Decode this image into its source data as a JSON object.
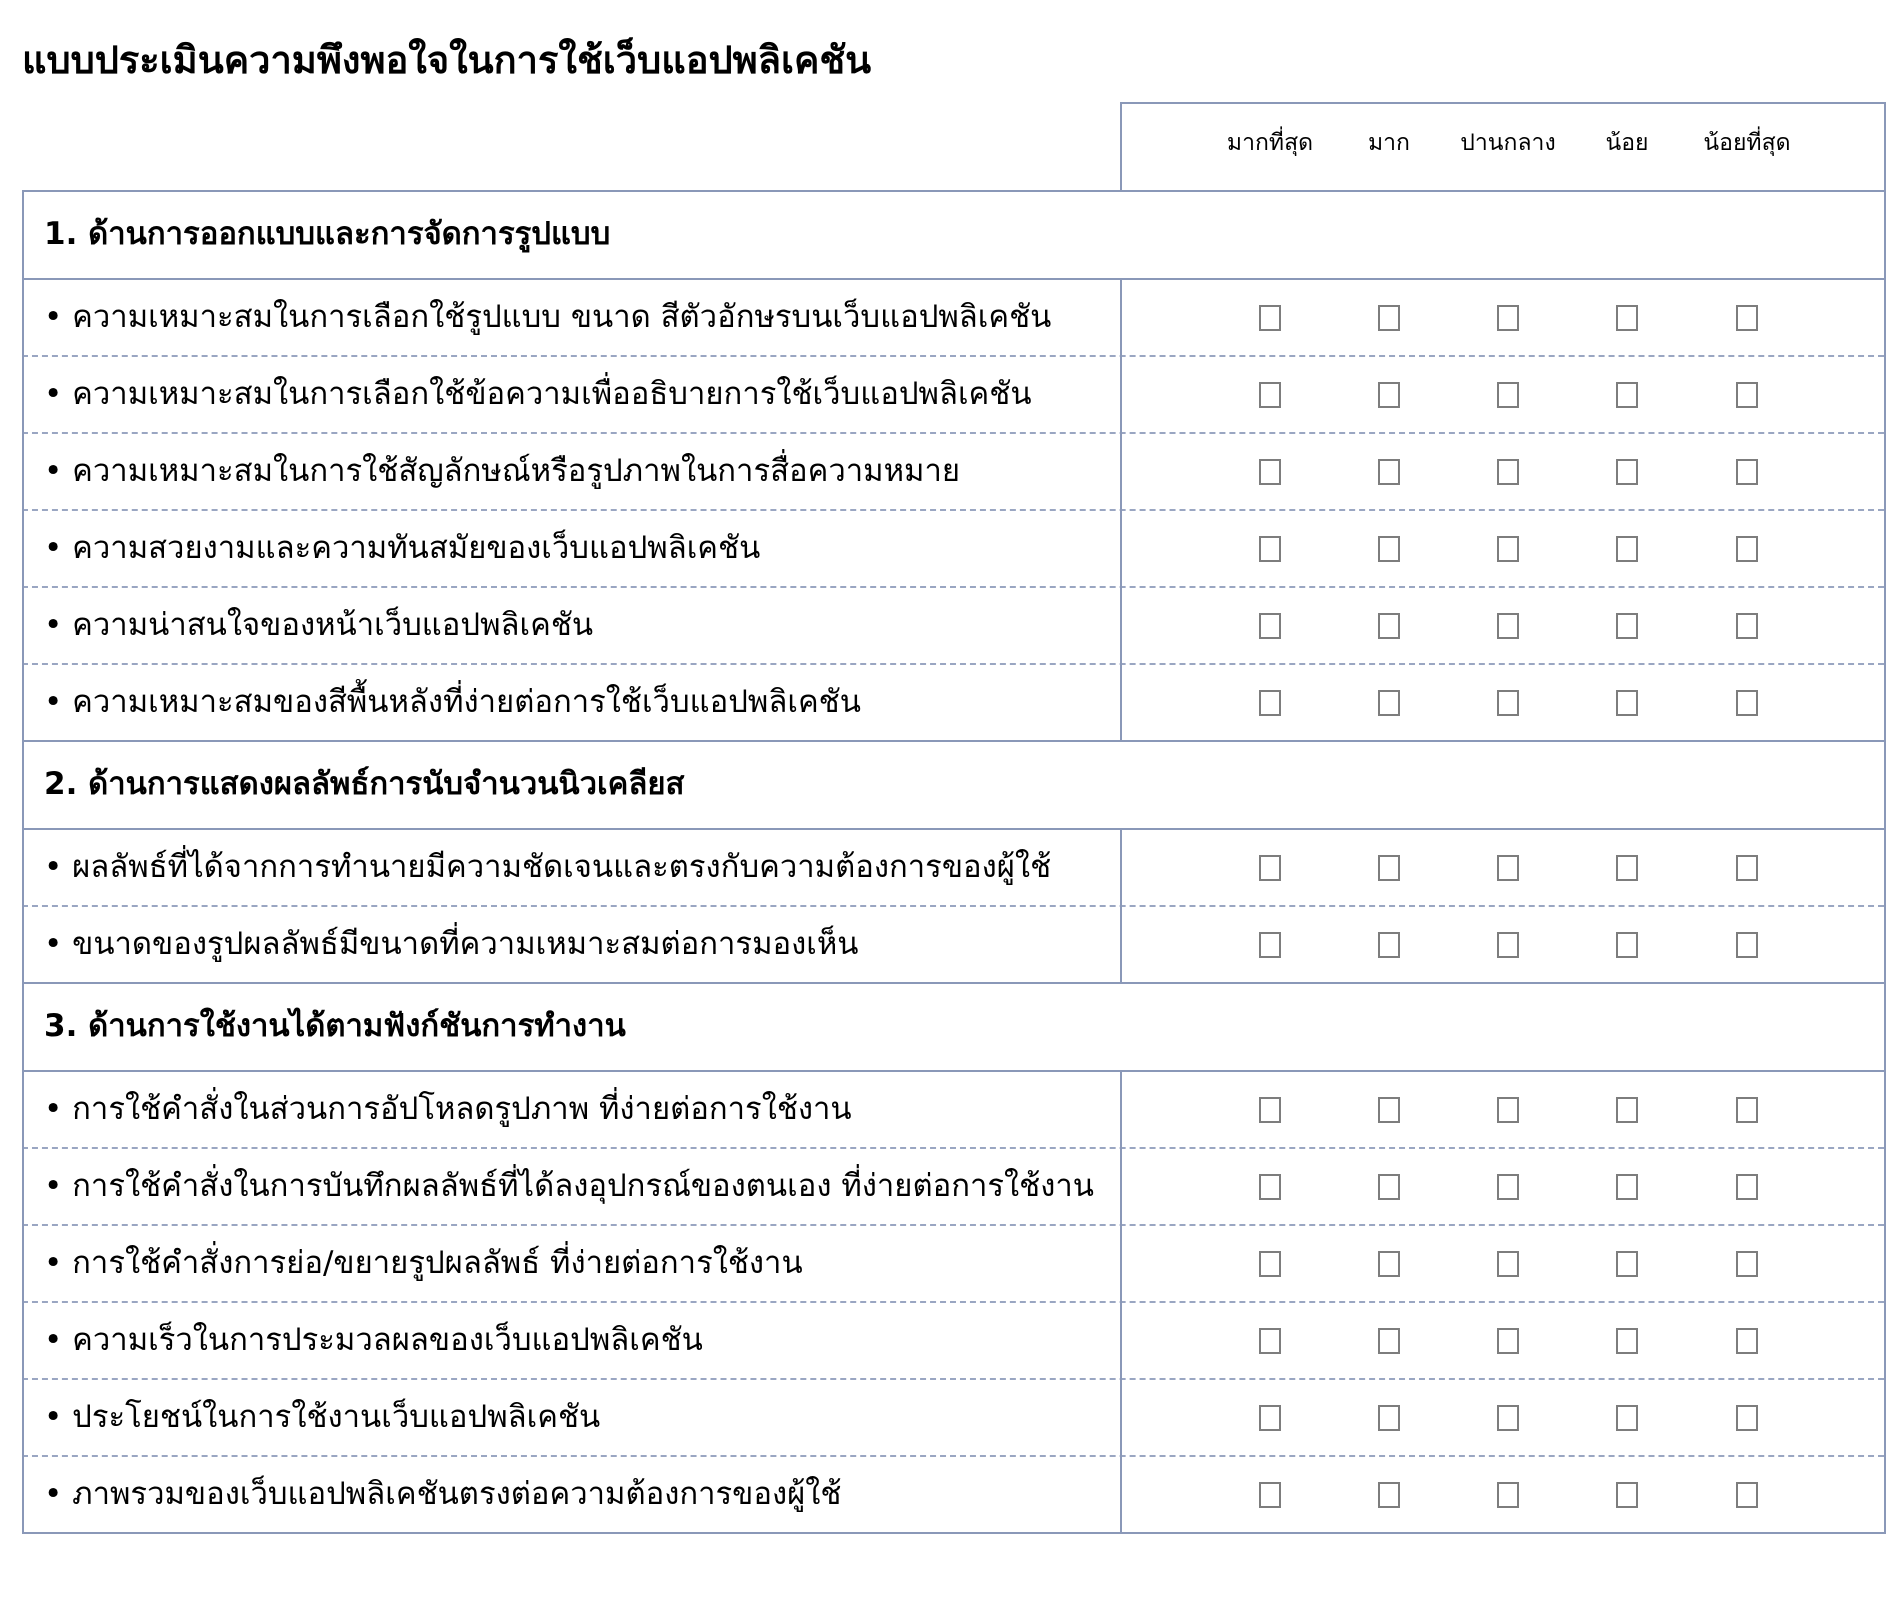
{
  "title": "แบบประเมินความพึงพอใจในการใช้เว็บแอปพลิเคชัน",
  "columns": [
    "มากที่สุด",
    "มาก",
    "ปานกลาง",
    "น้อย",
    "น้อยที่สุด"
  ],
  "sections": [
    {
      "heading": "1. ด้านการออกแบบและการจัดการรูปแบบ",
      "items": [
        "• ความเหมาะสมในการเลือกใช้รูปแบบ ขนาด สีตัวอักษรบนเว็บแอปพลิเคชัน",
        "• ความเหมาะสมในการเลือกใช้ข้อความเพื่ออธิบายการใช้เว็บแอปพลิเคชัน",
        "• ความเหมาะสมในการใช้สัญลักษณ์หรือรูปภาพในการสื่อความหมาย",
        "• ความสวยงามและความทันสมัยของเว็บแอปพลิเคชัน",
        "• ความน่าสนใจของหน้าเว็บแอปพลิเคชัน",
        "• ความเหมาะสมของสีพื้นหลังที่ง่ายต่อการใช้เว็บแอปพลิเคชัน"
      ]
    },
    {
      "heading": "2. ด้านการแสดงผลลัพธ์การนับจำนวนนิวเคลียส",
      "items": [
        "• ผลลัพธ์ที่ได้จากการทำนายมีความชัดเจนและตรงกับความต้องการของผู้ใช้",
        "• ขนาดของรูปผลลัพธ์มีขนาดที่ความเหมาะสมต่อการมองเห็น"
      ]
    },
    {
      "heading": "3. ด้านการใช้งานได้ตามฟังก์ชันการทำงาน",
      "items": [
        "• การใช้คำสั่งในส่วนการอัปโหลดรูปภาพ ที่ง่ายต่อการใช้งาน",
        "• การใช้คำสั่งในการบันทึกผลลัพธ์ที่ได้ลงอุปกรณ์ของตนเอง ที่ง่ายต่อการใช้งาน",
        "• การใช้คำสั่งการย่อ/ขยายรูปผลลัพธ์ ที่ง่ายต่อการใช้งาน",
        "• ความเร็วในการประมวลผลของเว็บแอปพลิเคชัน",
        "• ประโยชน์ในการใช้งานเว็บแอปพลิเคชัน",
        "• ภาพรวมของเว็บแอปพลิเคชันตรงต่อความต้องการของผู้ใช้"
      ]
    }
  ]
}
